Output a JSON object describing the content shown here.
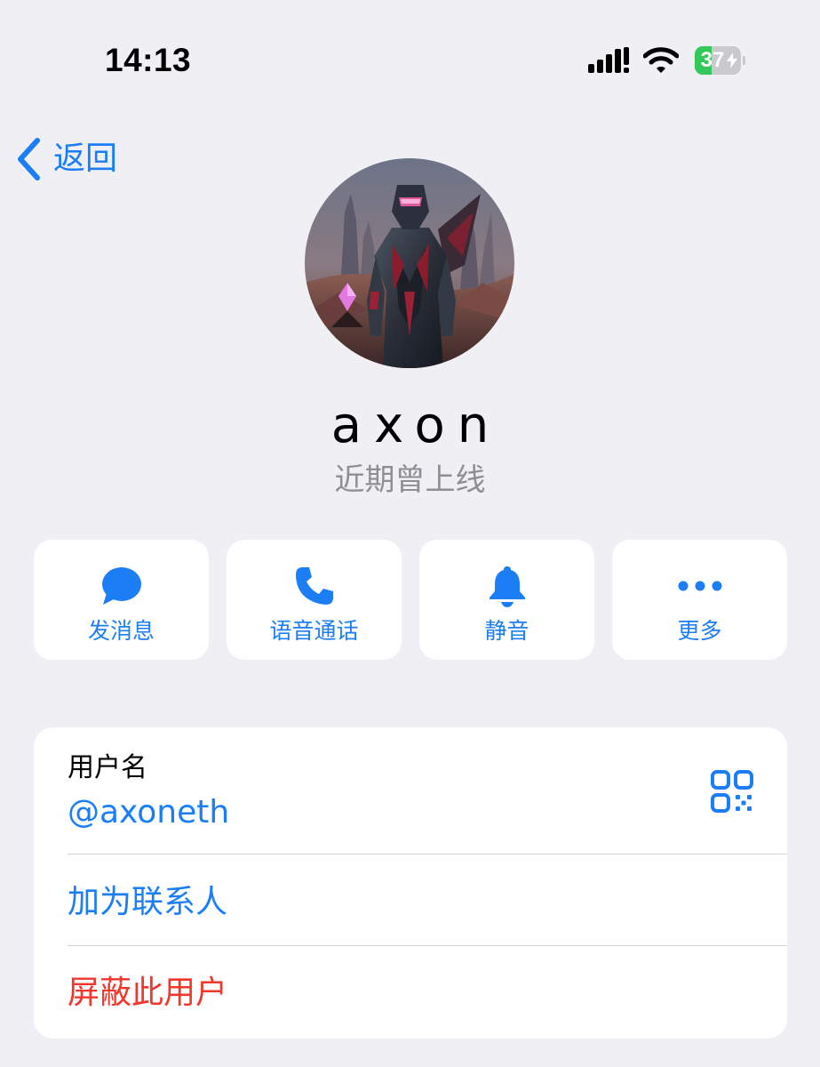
{
  "status_bar": {
    "time": "14:13",
    "battery_level": "37",
    "battery_color": "#34c759"
  },
  "nav": {
    "back_label": "返回"
  },
  "profile": {
    "name": "axon",
    "status": "近期曾上线"
  },
  "actions": [
    {
      "label": "发消息",
      "icon": "message-bubble-icon"
    },
    {
      "label": "语音通话",
      "icon": "phone-icon"
    },
    {
      "label": "静音",
      "icon": "bell-icon"
    },
    {
      "label": "更多",
      "icon": "more-dots-icon"
    }
  ],
  "info": {
    "username_label": "用户名",
    "username_value": "@axoneth",
    "qr_icon": "qr-code-icon",
    "add_contact": "加为联系人",
    "block_user": "屏蔽此用户"
  },
  "colors": {
    "accent": "#1b7ef5",
    "destructive": "#f0372c",
    "background": "#efeff4"
  }
}
